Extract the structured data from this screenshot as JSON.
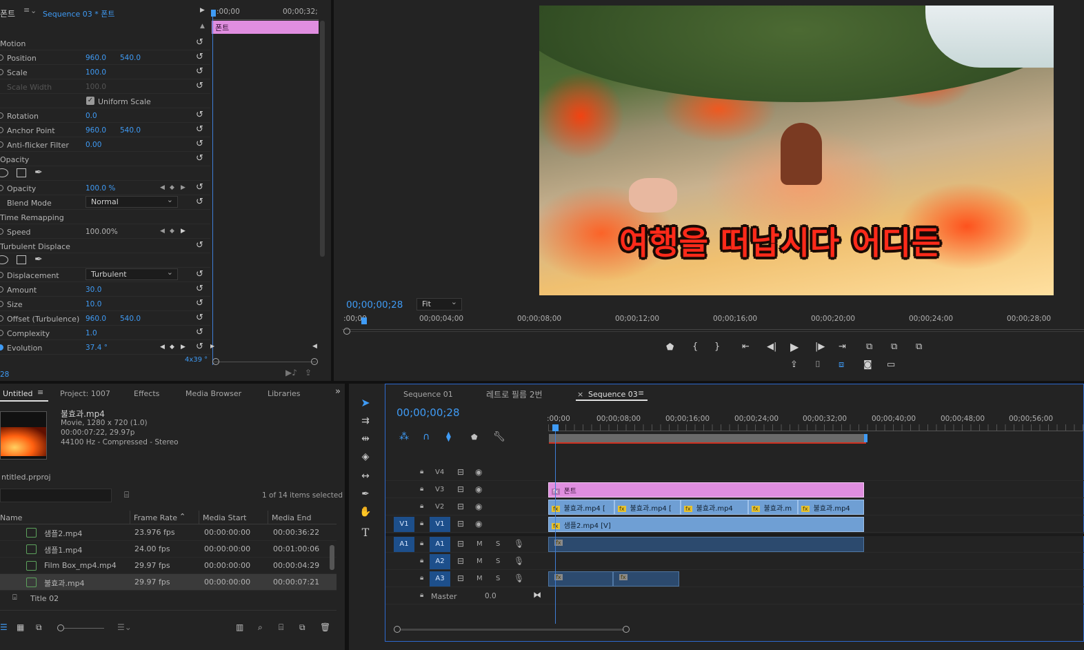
{
  "effect_controls": {
    "tab_label": "폰트",
    "sequence_label": "Sequence 03 * 폰트",
    "time_start": ":00;00",
    "time_end": "00;00;32;",
    "clip_label": "폰트",
    "motion": "Motion",
    "position": {
      "label": "Position",
      "x": "960.0",
      "y": "540.0"
    },
    "scale": {
      "label": "Scale",
      "value": "100.0"
    },
    "scale_width": {
      "label": "Scale Width",
      "value": "100.0"
    },
    "uniform_scale": "Uniform Scale",
    "rotation": {
      "label": "Rotation",
      "value": "0.0"
    },
    "anchor": {
      "label": "Anchor Point",
      "x": "960.0",
      "y": "540.0"
    },
    "antiflicker": {
      "label": "Anti-flicker Filter",
      "value": "0.00"
    },
    "opacity_group": "Opacity",
    "opacity": {
      "label": "Opacity",
      "value": "100.0 %"
    },
    "blend": {
      "label": "Blend Mode",
      "value": "Normal"
    },
    "time_remap": "Time Remapping",
    "speed": {
      "label": "Speed",
      "value": "100.00%"
    },
    "turbulent": "Turbulent Displace",
    "displacement": {
      "label": "Displacement",
      "value": "Turbulent"
    },
    "amount": {
      "label": "Amount",
      "value": "30.0"
    },
    "size": {
      "label": "Size",
      "value": "10.0"
    },
    "offset": {
      "label": "Offset (Turbulence)",
      "x": "960.0",
      "y": "540.0"
    },
    "complexity": {
      "label": "Complexity",
      "value": "1.0"
    },
    "evolution": {
      "label": "Evolution",
      "value": "37.4 °"
    },
    "zoom_label": "4x39 °",
    "bottom_time": "28"
  },
  "program": {
    "subtitle": "여행을 떠납시다 어디든",
    "timecode": "00;00;00;28",
    "fit": "Fit",
    "ruler": [
      ":00;00",
      "00;00;04;00",
      "00;00;08;00",
      "00;00;12;00",
      "00;00;16;00",
      "00;00;20;00",
      "00;00;24;00",
      "00;00;28;00"
    ]
  },
  "project": {
    "tabs": [
      "Untitled",
      "Project: 1007",
      "Effects",
      "Media Browser",
      "Libraries"
    ],
    "preview": {
      "name": "불효과.mp4",
      "info1": "Movie, 1280 x 720 (1.0)",
      "info2": "00:00:07:22, 29.97p",
      "info3": "44100 Hz - Compressed - Stereo"
    },
    "project_file": "ntitled.prproj",
    "selection": "1 of 14 items selected",
    "columns": [
      "Name",
      "Frame Rate",
      "Media Start",
      "Media End"
    ],
    "rows": [
      {
        "name": "샘플2.mp4",
        "rate": "23.976 fps",
        "start": "00:00:00:00",
        "end": "00:00:36:22"
      },
      {
        "name": "샘플1.mp4",
        "rate": "24.00 fps",
        "start": "00:00:00:00",
        "end": "00:01:00:06"
      },
      {
        "name": "Film Box_mp4.mp4",
        "rate": "29.97 fps",
        "start": "00:00:00:00",
        "end": "00:00:04:29"
      },
      {
        "name": "불효과.mp4",
        "rate": "29.97 fps",
        "start": "00:00:00:00",
        "end": "00:00:07:21"
      }
    ],
    "title_item": "Title 02"
  },
  "timeline": {
    "tabs": [
      "Sequence 01",
      "레트로 필름 2번",
      "Sequence 03"
    ],
    "timecode": "00;00;00;28",
    "ruler": [
      ":00;00",
      "00;00;08;00",
      "00;00;16;00",
      "00;00;24;00",
      "00;00;32;00",
      "00;00;40;00",
      "00;00;48;00",
      "00;00;56;00"
    ],
    "video_tracks": [
      "V4",
      "V3",
      "V2",
      "V1"
    ],
    "audio_tracks": [
      "A1",
      "A2",
      "A3"
    ],
    "master": "Master",
    "master_value": "0.0",
    "clip_v3": "폰트",
    "clips_v2": [
      "불효과.mp4 [",
      "불효과.mp4 [",
      "불효과.mp4",
      "불효과.m",
      "불효과.mp4"
    ],
    "clip_v1": "샘플2.mp4 [V]"
  },
  "colors": {
    "accent": "#3f9bf5",
    "clip_pink": "#e08ee0",
    "clip_blue": "#6f9fd4"
  }
}
